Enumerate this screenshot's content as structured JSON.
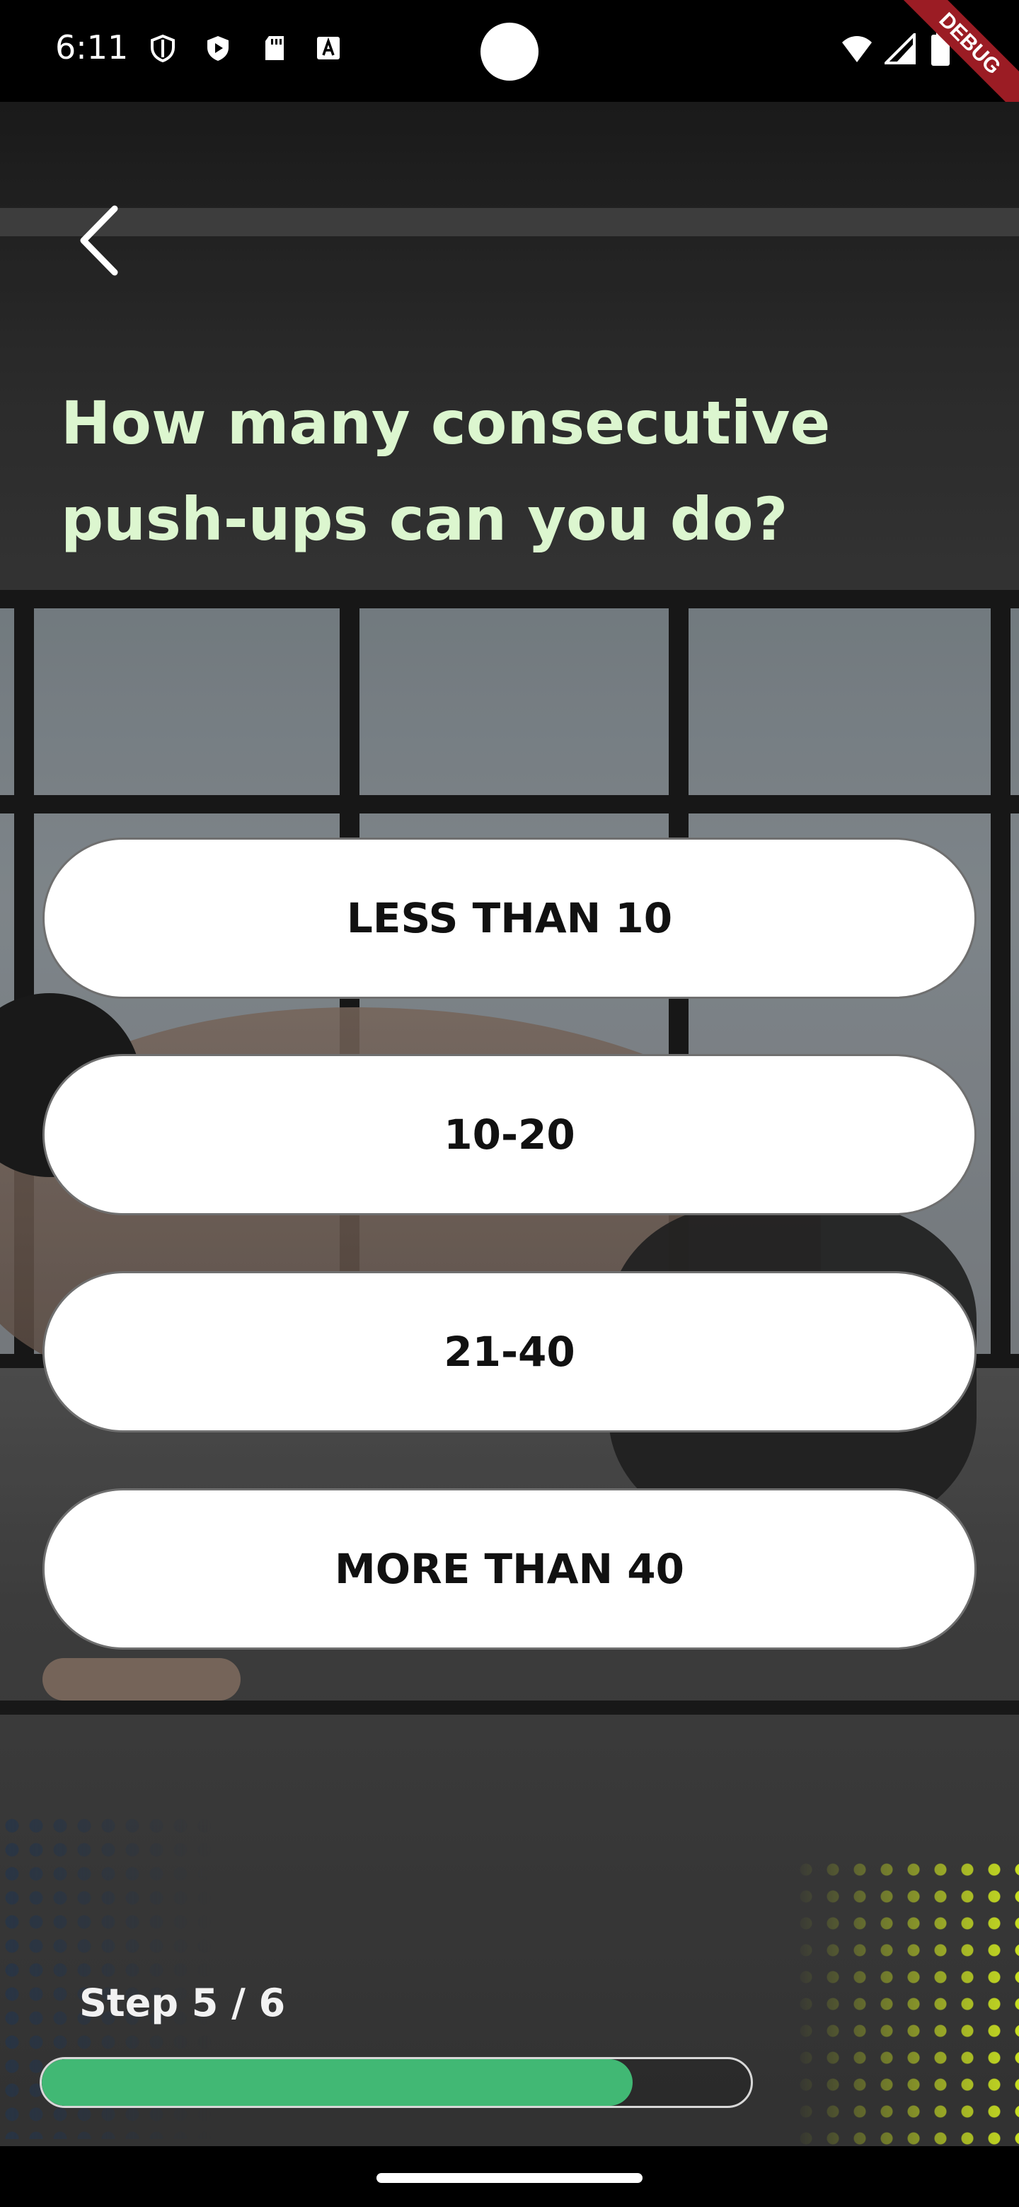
{
  "status_bar": {
    "time": "6:11",
    "debug_banner": "DEBUG",
    "icons": [
      "shield-icon",
      "play-protect-icon",
      "sd-card-icon",
      "font-a-icon",
      "wifi-icon",
      "signal-icon",
      "battery-icon"
    ]
  },
  "header": {
    "back_icon": "chevron-left-icon"
  },
  "question": {
    "title": "How many consecutive\npush-ups can you do?"
  },
  "options": [
    {
      "label": "LESS THAN 10"
    },
    {
      "label": "10-20"
    },
    {
      "label": "21-40"
    },
    {
      "label": "MORE THAN 40"
    }
  ],
  "progress": {
    "step_label": "Step 5 / 6",
    "value": 0.8333
  },
  "colors": {
    "title": "#dcf6cf",
    "progress_fill": "#41b874",
    "option_bg": "#ffffff",
    "accent_dots": "#d9f21f"
  }
}
